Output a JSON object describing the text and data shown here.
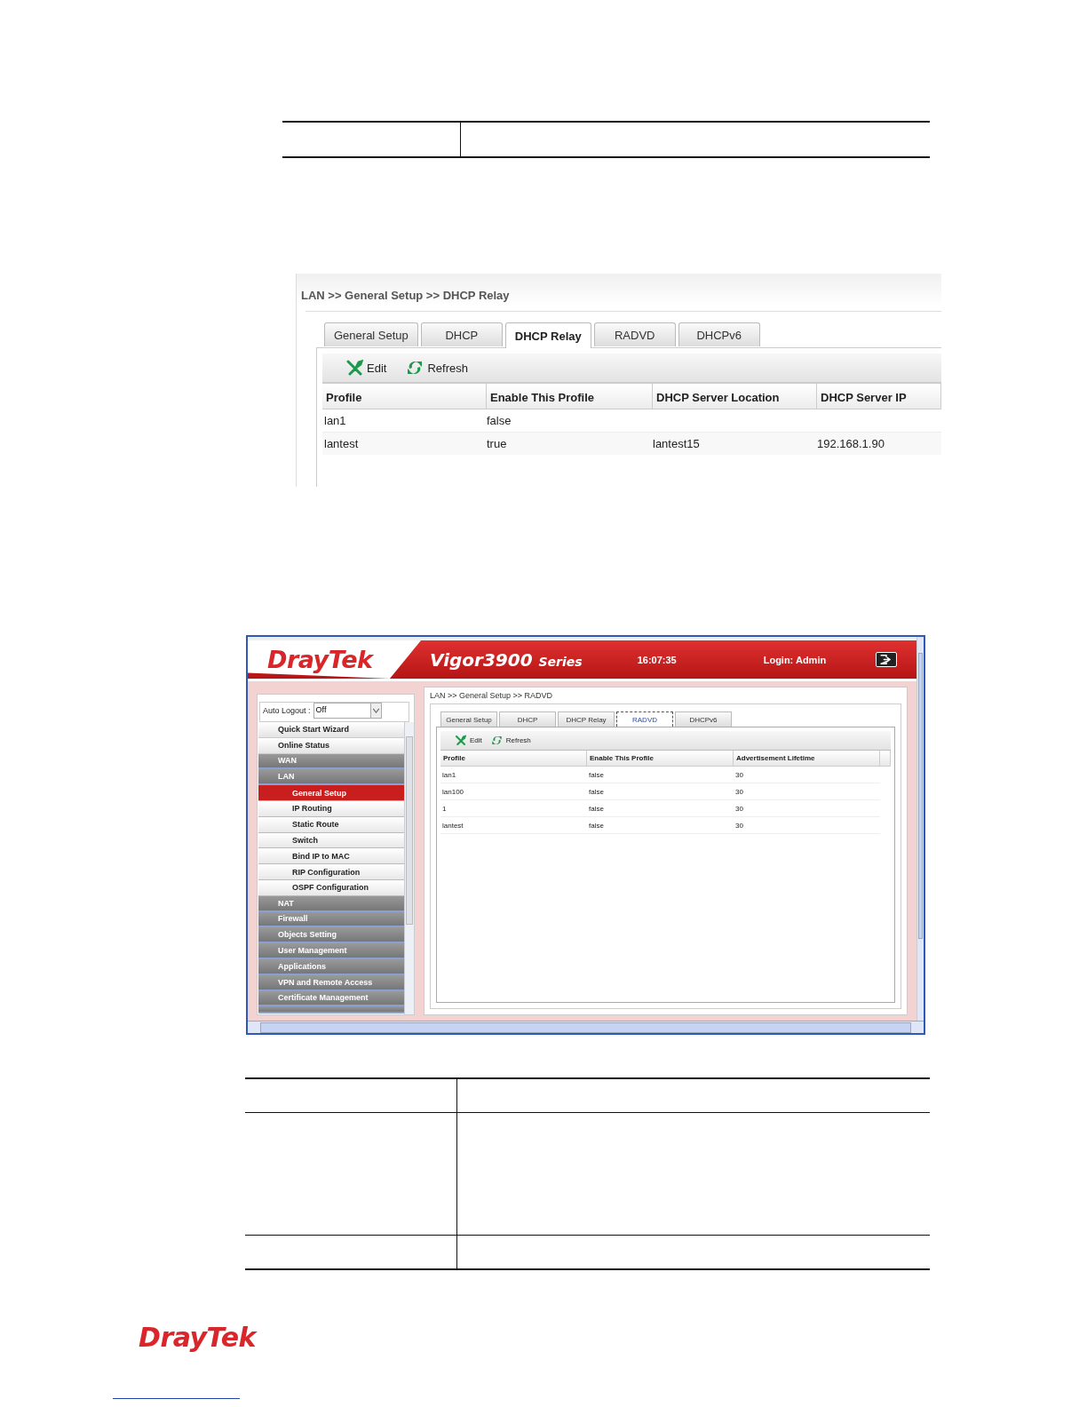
{
  "relay_screen": {
    "breadcrumb": "LAN >> General Setup >> DHCP Relay",
    "tabs": [
      {
        "label": "General Setup",
        "selected": false
      },
      {
        "label": "DHCP",
        "selected": false
      },
      {
        "label": "DHCP Relay",
        "selected": true
      },
      {
        "label": "RADVD",
        "selected": false
      },
      {
        "label": "DHCPv6",
        "selected": false
      }
    ],
    "toolbar": [
      {
        "label": "Edit",
        "kind": "edit"
      },
      {
        "label": "Refresh",
        "kind": "refresh"
      }
    ],
    "columns": [
      "Profile",
      "Enable This Profile",
      "DHCP Server Location",
      "DHCP Server IP"
    ],
    "rows": [
      {
        "cells": [
          "lan1",
          "false"
        ]
      },
      {
        "cells": [
          "lantest",
          "true",
          "lantest15",
          "192.168.1.90"
        ]
      }
    ]
  },
  "radvd_screen": {
    "logo": "DrayTek",
    "product": "Vigor3900",
    "series": "Series",
    "time": "16:07:35",
    "login": "Login: Admin",
    "auto_logout": {
      "label": "Auto Logout :",
      "value": "Off"
    },
    "sidebar": [
      {
        "label": "Quick Start Wizard",
        "kind": "page"
      },
      {
        "label": "Online Status",
        "kind": "page"
      },
      {
        "label": "WAN",
        "kind": "group"
      },
      {
        "label": "LAN",
        "kind": "group",
        "children": [
          {
            "label": "General Setup",
            "selected": true
          },
          {
            "label": "IP Routing",
            "selected": false
          },
          {
            "label": "Static Route",
            "selected": false
          },
          {
            "label": "Switch",
            "selected": false
          },
          {
            "label": "Bind IP to MAC",
            "selected": false
          },
          {
            "label": "RIP Configuration",
            "selected": false
          },
          {
            "label": "OSPF Configuration",
            "selected": false
          }
        ]
      },
      {
        "label": "NAT",
        "kind": "group"
      },
      {
        "label": "Firewall",
        "kind": "group"
      },
      {
        "label": "Objects Setting",
        "kind": "group"
      },
      {
        "label": "User Management",
        "kind": "group"
      },
      {
        "label": "Applications",
        "kind": "group"
      },
      {
        "label": "VPN and Remote Access",
        "kind": "group"
      },
      {
        "label": "Certificate Management",
        "kind": "group"
      }
    ],
    "breadcrumb": "LAN >> General Setup >> RADVD",
    "tabs": [
      {
        "label": "General Setup",
        "selected": false
      },
      {
        "label": "DHCP",
        "selected": false
      },
      {
        "label": "DHCP Relay",
        "selected": false
      },
      {
        "label": "RADVD",
        "selected": true
      },
      {
        "label": "DHCPv6",
        "selected": false
      }
    ],
    "toolbar": [
      {
        "label": "Edit",
        "kind": "edit"
      },
      {
        "label": "Refresh",
        "kind": "refresh"
      }
    ],
    "columns": [
      "Profile",
      "Enable This Profile",
      "Advertisement Lifetime"
    ],
    "rows": [
      {
        "cells": [
          "lan1",
          "false",
          "30"
        ]
      },
      {
        "cells": [
          "lan100",
          "false",
          "30"
        ]
      },
      {
        "cells": [
          "1",
          "false",
          "30"
        ]
      },
      {
        "cells": [
          "lantest",
          "false",
          "30"
        ]
      }
    ]
  },
  "footer_logo": "DrayTek"
}
